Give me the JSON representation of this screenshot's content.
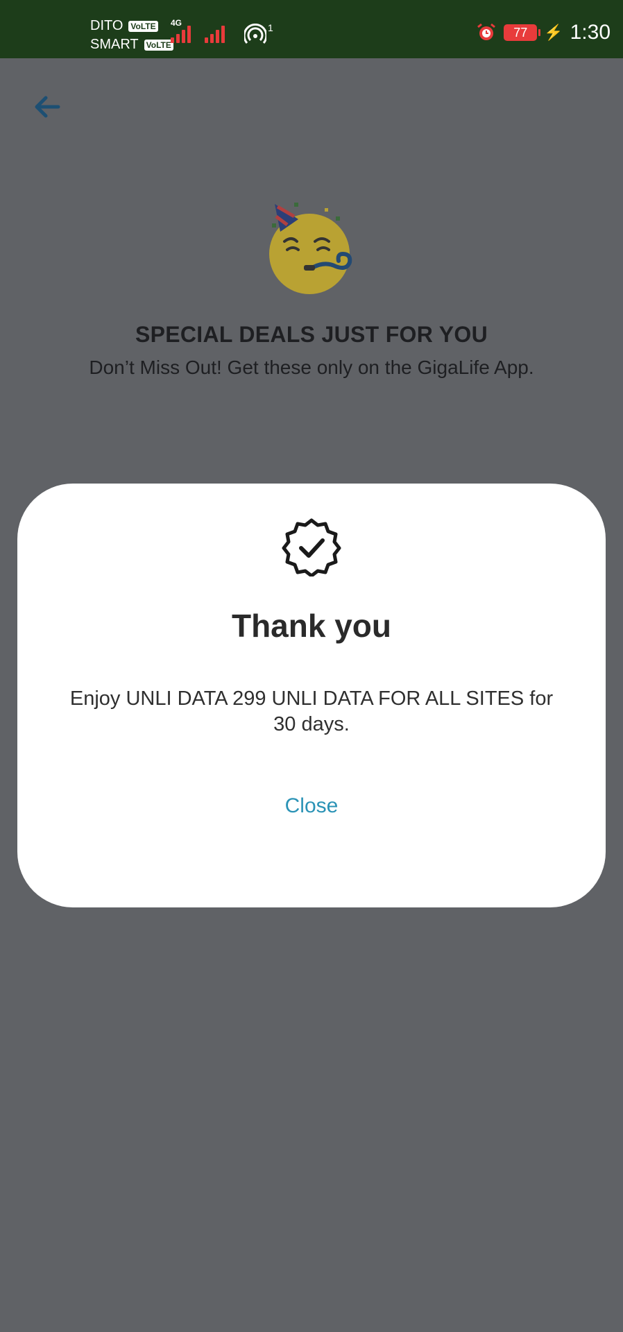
{
  "status_bar": {
    "carrier1": "DITO",
    "carrier2": "SMART",
    "volte": "VoLTE",
    "network": "4G",
    "hotspot_count": "1",
    "battery": "77",
    "time": "1:30"
  },
  "page": {
    "title": "SPECIAL DEALS JUST FOR YOU",
    "subtitle": "Don’t Miss Out! Get these only on the GigaLife App."
  },
  "modal": {
    "title": "Thank you",
    "message": "Enjoy UNLI DATA 299 UNLI DATA FOR ALL SITES for 30 days.",
    "close_label": "Close"
  },
  "colors": {
    "status_bar": "#1d3d1a",
    "overlay": "#606266",
    "accent": "#2b93b6",
    "signal": "#e83b3b"
  }
}
